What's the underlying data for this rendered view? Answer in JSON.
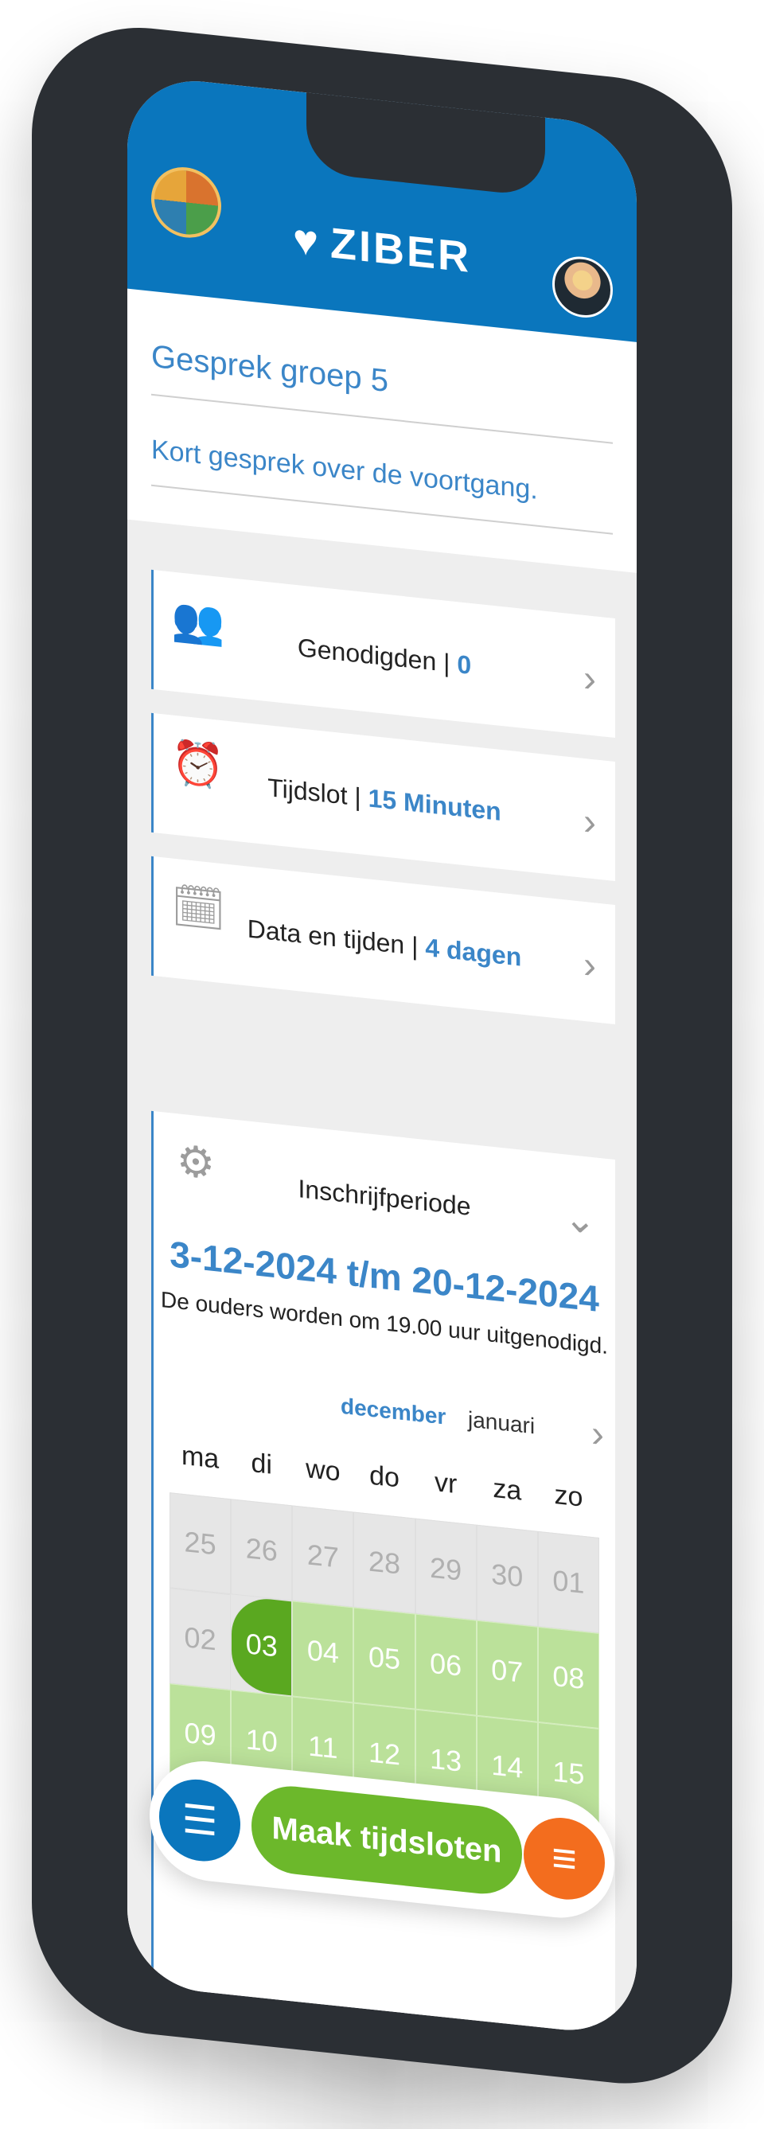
{
  "app": {
    "brand": "ZIBER",
    "brand_mark": "♥"
  },
  "header": {
    "logo_icon": "school-logo",
    "avatar_icon": "user-avatar"
  },
  "form": {
    "title_value": "Gesprek groep 5",
    "description_value": "Kort gesprek over de voortgang."
  },
  "cards": [
    {
      "label": "Genodigden",
      "separator": " | ",
      "value": "0",
      "icon": "people-icon",
      "glyph": "👥",
      "chevron": "›"
    },
    {
      "label": "Tijdslot",
      "separator": " | ",
      "value": "15 Minuten",
      "icon": "alarm-clock-icon",
      "glyph": "⏰",
      "chevron": "›"
    },
    {
      "label": "Data en tijden",
      "separator": " | ",
      "value": "4 dagen",
      "icon": "calendar-icon",
      "glyph": "🗓",
      "chevron": "›"
    }
  ],
  "period": {
    "label": "Inschrijfperiode",
    "icon": "gear-icon",
    "glyph": "⚙",
    "chevron": "⌄",
    "range": "3-12-2024 t/m 20-12-2024",
    "note": "De ouders worden om 19.00 uur uitgenodigd.",
    "month_current": "december",
    "month_next": "januari",
    "month_chevron": "›"
  },
  "calendar": {
    "weekdays": [
      "ma",
      "di",
      "wo",
      "do",
      "vr",
      "za",
      "zo"
    ],
    "row1": [
      "25",
      "26",
      "27",
      "28",
      "29",
      "30",
      "01"
    ],
    "row2": [
      "02",
      "03",
      "04",
      "05",
      "06",
      "07",
      "08"
    ],
    "row3": [
      "09",
      "10",
      "11",
      "12",
      "13",
      "14",
      "15"
    ]
  },
  "bottombar": {
    "left_icon": "list-icon",
    "left_glyph": "☰",
    "main_label": "Maak tijdsloten",
    "right_icon": "menu-icon",
    "right_glyph": "≡"
  },
  "colors": {
    "primary": "#0a76bd",
    "accent_green": "#6cb82b",
    "calendar_selected": "#5aa820",
    "calendar_range": "#bbe19a",
    "orange": "#f36d1e",
    "link_blue": "#3b86c8"
  }
}
